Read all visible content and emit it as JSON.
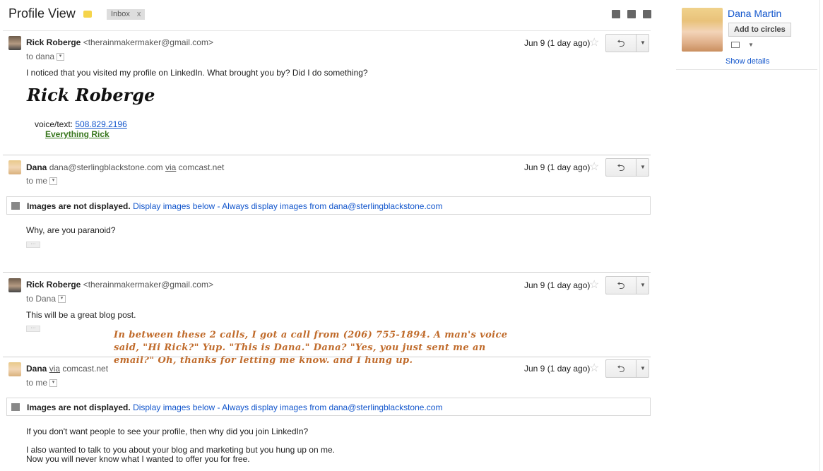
{
  "header": {
    "title": "Profile View",
    "chip_label": "Inbox",
    "chip_close": "x"
  },
  "messages": [
    {
      "sender": "Rick Roberge",
      "address": "<therainmakermaker@gmail.com>",
      "to": "to dana",
      "date": "Jun 9 (1 day ago)",
      "body": "I noticed that you visited my profile on LinkedIn. What brought you by? Did I do something?",
      "signature_name": "Rick Roberge",
      "voice_label": "voice/text:",
      "phone": "508.829.2196",
      "sig_link": "Everything Rick"
    },
    {
      "sender": "Dana",
      "address": "dana@sterlingblackstone.com",
      "via": "via",
      "via_domain": "comcast.net",
      "to": "to me",
      "date": "Jun 9 (1 day ago)",
      "images_notice": "Images are not displayed.",
      "display_below": "Display images below",
      "sep": " - ",
      "always_display": "Always display images from dana@sterlingblackstone.com",
      "body": "Why, are you paranoid?"
    },
    {
      "sender": "Rick Roberge",
      "address": "<therainmakermaker@gmail.com>",
      "to": "to Dana",
      "date": "Jun 9 (1 day ago)",
      "body": "This will be a great blog post."
    },
    {
      "sender": "Dana",
      "via": "via",
      "via_domain": "comcast.net",
      "to": "to me",
      "date": "Jun 9 (1 day ago)",
      "images_notice": "Images are not displayed.",
      "display_below": "Display images below",
      "sep": " - ",
      "always_display": "Always display images from dana@sterlingblackstone.com",
      "body1": "If you don't want people to see your profile, then why did you join LinkedIn?",
      "body2": "I also wanted to talk to you about your blog and marketing but you hung up on me.",
      "body3": "Now you will never know what I wanted to offer you for free."
    }
  ],
  "annotation": {
    "line1": "In between these 2 calls, I got a call from (206) 755-1894. A man's voice",
    "line2": "said, \"Hi Rick?\" Yup. \"This is Dana.\" Dana? \"Yes, you just sent me an",
    "line3": "email?\" Oh, thanks for letting me know. and I hung up."
  },
  "profile": {
    "name": "Dana Martin",
    "add_circles": "Add to circles",
    "show_details": "Show details"
  },
  "icons": {
    "reply": "reply-arrow-icon",
    "star": "star-icon",
    "more": "chevron-down-icon"
  }
}
